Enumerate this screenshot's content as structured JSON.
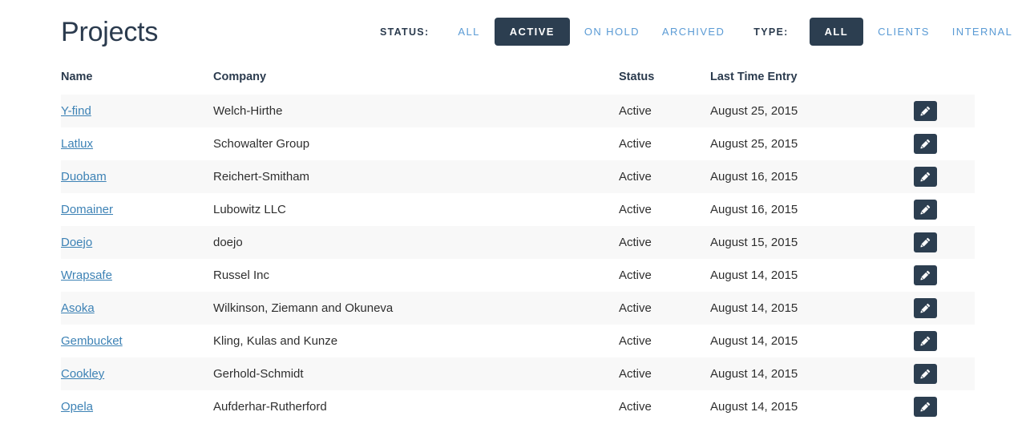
{
  "header": {
    "title": "Projects",
    "status_filter": {
      "label": "STATUS:",
      "options": [
        {
          "label": "ALL",
          "active": false
        },
        {
          "label": "ACTIVE",
          "active": true
        },
        {
          "label": "ON HOLD",
          "active": false
        },
        {
          "label": "ARCHIVED",
          "active": false
        }
      ]
    },
    "type_filter": {
      "label": "TYPE:",
      "options": [
        {
          "label": "ALL",
          "active": true
        },
        {
          "label": "CLIENTS",
          "active": false
        },
        {
          "label": "INTERNAL",
          "active": false
        }
      ]
    }
  },
  "table": {
    "columns": [
      "Name",
      "Company",
      "Status",
      "Last Time Entry",
      ""
    ],
    "edit_icon": "pencil-icon",
    "rows": [
      {
        "name": "Y-find",
        "company": "Welch-Hirthe",
        "status": "Active",
        "last_time_entry": "August 25, 2015"
      },
      {
        "name": "Latlux",
        "company": "Schowalter Group",
        "status": "Active",
        "last_time_entry": "August 25, 2015"
      },
      {
        "name": "Duobam",
        "company": "Reichert-Smitham",
        "status": "Active",
        "last_time_entry": "August 16, 2015"
      },
      {
        "name": "Domainer",
        "company": "Lubowitz LLC",
        "status": "Active",
        "last_time_entry": "August 16, 2015"
      },
      {
        "name": "Doejo",
        "company": "doejo",
        "status": "Active",
        "last_time_entry": "August 15, 2015"
      },
      {
        "name": "Wrapsafe",
        "company": "Russel Inc",
        "status": "Active",
        "last_time_entry": "August 14, 2015"
      },
      {
        "name": "Asoka",
        "company": "Wilkinson, Ziemann and Okuneva",
        "status": "Active",
        "last_time_entry": "August 14, 2015"
      },
      {
        "name": "Gembucket",
        "company": "Kling, Kulas and Kunze",
        "status": "Active",
        "last_time_entry": "August 14, 2015"
      },
      {
        "name": "Cookley",
        "company": "Gerhold-Schmidt",
        "status": "Active",
        "last_time_entry": "August 14, 2015"
      },
      {
        "name": "Opela",
        "company": "Aufderhar-Rutherford",
        "status": "Active",
        "last_time_entry": "August 14, 2015"
      }
    ]
  },
  "colors": {
    "accent_dark": "#2c3e50",
    "link_blue": "#3d82b5",
    "filter_link_blue": "#5b9bd5",
    "stripe": "#f8f8f8",
    "text": "#2f2f2f"
  }
}
